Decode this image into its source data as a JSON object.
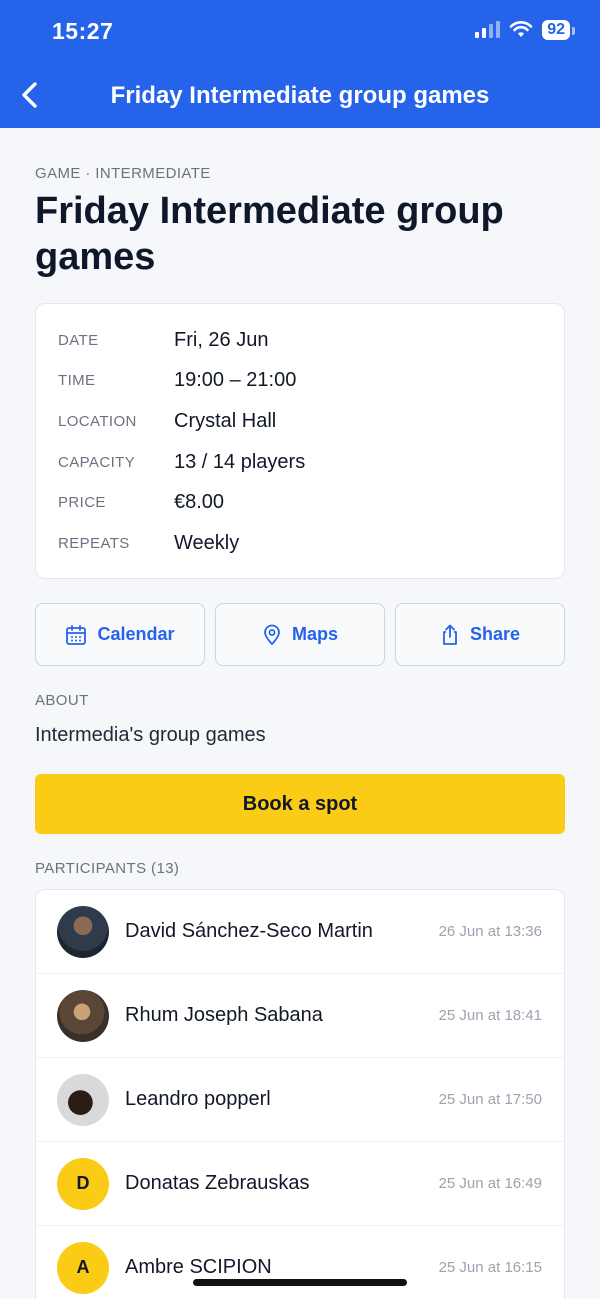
{
  "status_bar": {
    "time": "15:27",
    "battery": "92"
  },
  "nav": {
    "title": "Friday Intermediate group games"
  },
  "header": {
    "eyebrow": "GAME · INTERMEDIATE",
    "title": "Friday Intermediate group games"
  },
  "details": [
    {
      "label": "DATE",
      "value": "Fri, 26 Jun"
    },
    {
      "label": "TIME",
      "value": "19:00 – 21:00"
    },
    {
      "label": "LOCATION",
      "value": "Crystal Hall"
    },
    {
      "label": "CAPACITY",
      "value": "13 / 14 players"
    },
    {
      "label": "PRICE",
      "value": "€8.00"
    },
    {
      "label": "REPEATS",
      "value": "Weekly"
    }
  ],
  "actions": {
    "calendar": "Calendar",
    "maps": "Maps",
    "share": "Share"
  },
  "about": {
    "label": "ABOUT",
    "text": "Intermedia's group games"
  },
  "book": {
    "label": "Book a spot"
  },
  "participants": {
    "label": "PARTICIPANTS (13)",
    "items": [
      {
        "name": "David Sánchez-Seco Martin",
        "time": "26 Jun at 13:36",
        "avatar": "photo"
      },
      {
        "name": "Rhum Joseph Sabana",
        "time": "25 Jun at 18:41",
        "avatar": "photo"
      },
      {
        "name": "Leandro popperl",
        "time": "25 Jun at 17:50",
        "avatar": "photo"
      },
      {
        "name": "Donatas Zebrauskas",
        "time": "25 Jun at 16:49",
        "initial": "D"
      },
      {
        "name": "Ambre SCIPION",
        "time": "25 Jun at 16:15",
        "initial": "A"
      }
    ]
  },
  "colors": {
    "primary": "#2563eb",
    "accent": "#facc15",
    "background": "#f5f7fa"
  }
}
